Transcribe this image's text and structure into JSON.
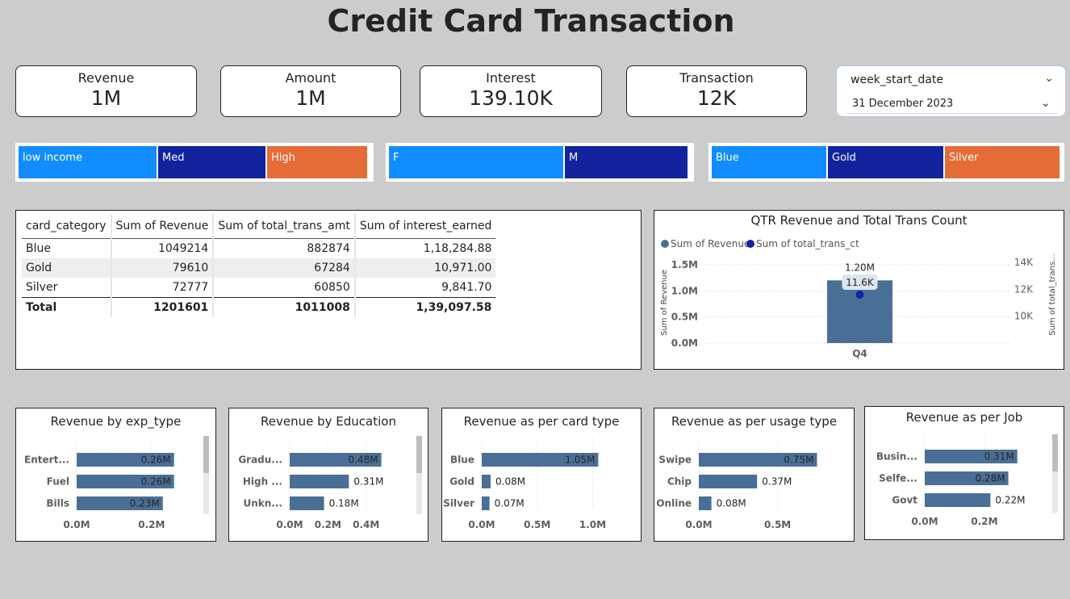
{
  "title": "Credit Card Transaction",
  "kpis": [
    {
      "label": "Revenue",
      "value": "1M"
    },
    {
      "label": "Amount",
      "value": "1M"
    },
    {
      "label": "Interest",
      "value": "139.10K"
    },
    {
      "label": "Transaction",
      "value": "12K"
    }
  ],
  "slicer": {
    "field": "week_start_date",
    "selected": "31 December 2023"
  },
  "segments": {
    "income": [
      "low income",
      "Med",
      "High"
    ],
    "gender": [
      "F",
      "M"
    ],
    "card": [
      "Blue",
      "Gold",
      "Silver"
    ]
  },
  "colors": {
    "blue": "#118dff",
    "navy": "#12239e",
    "orange": "#e66c37",
    "bar": "#4a6f96",
    "dot": "#12239e"
  },
  "table": {
    "headers": [
      "card_category",
      "Sum of Revenue",
      "Sum of total_trans_amt",
      "Sum of interest_earned"
    ],
    "rows": [
      [
        "Blue",
        "1049214",
        "882874",
        "1,18,284.88"
      ],
      [
        "Gold",
        "79610",
        "67284",
        "10,971.00"
      ],
      [
        "Silver",
        "72777",
        "60850",
        "9,841.70"
      ]
    ],
    "total": [
      "Total",
      "1201601",
      "1011008",
      "1,39,097.58"
    ]
  },
  "combo": {
    "title": "QTR Revenue and Total Trans Count",
    "legend": [
      "Sum of Revenue",
      "Sum of total_trans_ct"
    ],
    "y_label": "Sum of Revenue",
    "y2_label": "Sum of total_trans...",
    "chart_data": {
      "type": "bar",
      "categories": [
        "Q4"
      ],
      "series": [
        {
          "name": "Sum of Revenue",
          "values": [
            1201601
          ],
          "label": "1.20M"
        },
        {
          "name": "Sum of total_trans_ct",
          "values": [
            11600
          ],
          "label": "11.6K"
        }
      ],
      "y_ticks": [
        "0.0M",
        "0.5M",
        "1.0M",
        "1.5M"
      ],
      "y2_ticks": [
        "10K",
        "12K",
        "14K"
      ],
      "ylim": [
        0,
        1500000
      ],
      "y2lim": [
        8000,
        14000
      ]
    }
  },
  "bar_charts": [
    {
      "title": "Revenue by exp_type",
      "categories": [
        "Entert...",
        "Fuel",
        "Bills"
      ],
      "values": [
        0.26,
        0.26,
        0.23
      ],
      "labels": [
        "0.26M",
        "0.26M",
        "0.23M"
      ],
      "ticks": [
        "0.0M",
        "0.2M"
      ],
      "tick_values": [
        0,
        0.2
      ],
      "xmax": 0.28,
      "label_inside": [
        true,
        true,
        true
      ]
    },
    {
      "title": "Revenue by Education",
      "categories": [
        "Gradu...",
        "High ...",
        "Unkn..."
      ],
      "values": [
        0.48,
        0.31,
        0.18
      ],
      "labels": [
        "0.48M",
        "0.31M",
        "0.18M"
      ],
      "ticks": [
        "0.0M",
        "0.2M",
        "0.4M"
      ],
      "tick_values": [
        0,
        0.2,
        0.4
      ],
      "xmax": 0.6,
      "label_inside": [
        true,
        false,
        false
      ]
    },
    {
      "title": "Revenue as per card type",
      "categories": [
        "Blue",
        "Gold",
        "Silver"
      ],
      "values": [
        1.05,
        0.08,
        0.07
      ],
      "labels": [
        "1.05M",
        "0.08M",
        "0.07M"
      ],
      "ticks": [
        "0.0M",
        "0.5M",
        "1.0M"
      ],
      "tick_values": [
        0,
        0.5,
        1.0
      ],
      "xmax": 1.2,
      "label_inside": [
        true,
        false,
        false
      ]
    },
    {
      "title": "Revenue as per usage type",
      "categories": [
        "Swipe",
        "Chip",
        "Online"
      ],
      "values": [
        0.75,
        0.37,
        0.08
      ],
      "labels": [
        "0.75M",
        "0.37M",
        "0.08M"
      ],
      "ticks": [
        "0.0M",
        "0.5M"
      ],
      "tick_values": [
        0,
        0.5
      ],
      "xmax": 0.85,
      "label_inside": [
        true,
        false,
        false
      ]
    },
    {
      "title": "Revenue as per Job",
      "categories": [
        "Busin...",
        "Selfe...",
        "Govt"
      ],
      "values": [
        0.31,
        0.28,
        0.22
      ],
      "labels": [
        "0.31M",
        "0.28M",
        "0.22M"
      ],
      "ticks": [
        "0.0M",
        "0.2M"
      ],
      "tick_values": [
        0,
        0.2
      ],
      "xmax": 0.4,
      "label_inside": [
        true,
        true,
        false
      ]
    }
  ]
}
